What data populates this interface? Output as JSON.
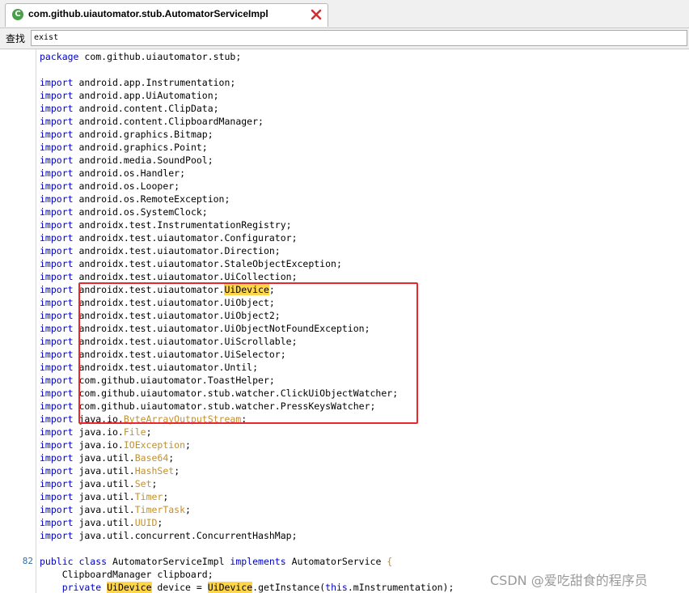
{
  "tab": {
    "title": "com.github.uiautomator.stub.AutomatorServiceImpl",
    "icon": "class-icon",
    "close_icon": "close-icon"
  },
  "find": {
    "label": "查找",
    "value": "exist"
  },
  "highlight_word": "UiDevice",
  "code_lines": [
    {
      "ln": "",
      "segs": [
        [
          "kw",
          "package"
        ],
        [
          "t",
          " com.github.uiautomator.stub;"
        ]
      ]
    },
    {
      "ln": "",
      "segs": []
    },
    {
      "ln": "",
      "segs": [
        [
          "kw",
          "import"
        ],
        [
          "t",
          " android.app.Instrumentation;"
        ]
      ]
    },
    {
      "ln": "",
      "segs": [
        [
          "kw",
          "import"
        ],
        [
          "t",
          " android.app.UiAutomation;"
        ]
      ]
    },
    {
      "ln": "",
      "segs": [
        [
          "kw",
          "import"
        ],
        [
          "t",
          " android.content.ClipData;"
        ]
      ]
    },
    {
      "ln": "",
      "segs": [
        [
          "kw",
          "import"
        ],
        [
          "t",
          " android.content.ClipboardManager;"
        ]
      ]
    },
    {
      "ln": "",
      "segs": [
        [
          "kw",
          "import"
        ],
        [
          "t",
          " android.graphics.Bitmap;"
        ]
      ]
    },
    {
      "ln": "",
      "segs": [
        [
          "kw",
          "import"
        ],
        [
          "t",
          " android.graphics.Point;"
        ]
      ]
    },
    {
      "ln": "",
      "segs": [
        [
          "kw",
          "import"
        ],
        [
          "t",
          " android.media.SoundPool;"
        ]
      ]
    },
    {
      "ln": "",
      "segs": [
        [
          "kw",
          "import"
        ],
        [
          "t",
          " android.os.Handler;"
        ]
      ]
    },
    {
      "ln": "",
      "segs": [
        [
          "kw",
          "import"
        ],
        [
          "t",
          " android.os.Looper;"
        ]
      ]
    },
    {
      "ln": "",
      "segs": [
        [
          "kw",
          "import"
        ],
        [
          "t",
          " android.os.RemoteException;"
        ]
      ]
    },
    {
      "ln": "",
      "segs": [
        [
          "kw",
          "import"
        ],
        [
          "t",
          " android.os.SystemClock;"
        ]
      ]
    },
    {
      "ln": "",
      "segs": [
        [
          "kw",
          "import"
        ],
        [
          "t",
          " androidx.test.InstrumentationRegistry;"
        ]
      ]
    },
    {
      "ln": "",
      "segs": [
        [
          "kw",
          "import"
        ],
        [
          "t",
          " androidx.test.uiautomator.Configurator;"
        ]
      ]
    },
    {
      "ln": "",
      "segs": [
        [
          "kw",
          "import"
        ],
        [
          "t",
          " androidx.test.uiautomator.Direction;"
        ]
      ]
    },
    {
      "ln": "",
      "segs": [
        [
          "kw",
          "import"
        ],
        [
          "t",
          " androidx.test.uiautomator.StaleObjectException;"
        ]
      ]
    },
    {
      "ln": "",
      "segs": [
        [
          "kw",
          "import"
        ],
        [
          "t",
          " androidx.test.uiautomator.UiCollection;"
        ]
      ]
    },
    {
      "ln": "",
      "segs": [
        [
          "kw",
          "import"
        ],
        [
          "t",
          " androidx.test.uiautomator."
        ],
        [
          "hl",
          "UiDevice"
        ],
        [
          "t",
          ";"
        ]
      ]
    },
    {
      "ln": "",
      "segs": [
        [
          "kw",
          "import"
        ],
        [
          "t",
          " androidx.test.uiautomator.UiObject;"
        ]
      ]
    },
    {
      "ln": "",
      "segs": [
        [
          "kw",
          "import"
        ],
        [
          "t",
          " androidx.test.uiautomator.UiObject2;"
        ]
      ]
    },
    {
      "ln": "",
      "segs": [
        [
          "kw",
          "import"
        ],
        [
          "t",
          " androidx.test.uiautomator.UiObjectNotFoundException;"
        ]
      ]
    },
    {
      "ln": "",
      "segs": [
        [
          "kw",
          "import"
        ],
        [
          "t",
          " androidx.test.uiautomator.UiScrollable;"
        ]
      ]
    },
    {
      "ln": "",
      "segs": [
        [
          "kw",
          "import"
        ],
        [
          "t",
          " androidx.test.uiautomator.UiSelector;"
        ]
      ]
    },
    {
      "ln": "",
      "segs": [
        [
          "kw",
          "import"
        ],
        [
          "t",
          " androidx.test.uiautomator.Until;"
        ]
      ]
    },
    {
      "ln": "",
      "segs": [
        [
          "kw",
          "import"
        ],
        [
          "t",
          " com.github.uiautomator.ToastHelper;"
        ]
      ]
    },
    {
      "ln": "",
      "segs": [
        [
          "kw",
          "import"
        ],
        [
          "t",
          " com.github.uiautomator.stub.watcher.ClickUiObjectWatcher;"
        ]
      ]
    },
    {
      "ln": "",
      "segs": [
        [
          "kw",
          "import"
        ],
        [
          "t",
          " com.github.uiautomator.stub.watcher.PressKeysWatcher;"
        ]
      ]
    },
    {
      "ln": "",
      "segs": [
        [
          "kw",
          "import"
        ],
        [
          "t",
          " java.io."
        ],
        [
          "cls",
          "ByteArrayOutputStream"
        ],
        [
          "t",
          ";"
        ]
      ]
    },
    {
      "ln": "",
      "segs": [
        [
          "kw",
          "import"
        ],
        [
          "t",
          " java.io."
        ],
        [
          "cls",
          "File"
        ],
        [
          "t",
          ";"
        ]
      ]
    },
    {
      "ln": "",
      "segs": [
        [
          "kw",
          "import"
        ],
        [
          "t",
          " java.io."
        ],
        [
          "cls",
          "IOException"
        ],
        [
          "t",
          ";"
        ]
      ]
    },
    {
      "ln": "",
      "segs": [
        [
          "kw",
          "import"
        ],
        [
          "t",
          " java.util."
        ],
        [
          "cls",
          "Base64"
        ],
        [
          "t",
          ";"
        ]
      ]
    },
    {
      "ln": "",
      "segs": [
        [
          "kw",
          "import"
        ],
        [
          "t",
          " java.util."
        ],
        [
          "cls",
          "HashSet"
        ],
        [
          "t",
          ";"
        ]
      ]
    },
    {
      "ln": "",
      "segs": [
        [
          "kw",
          "import"
        ],
        [
          "t",
          " java.util."
        ],
        [
          "cls",
          "Set"
        ],
        [
          "t",
          ";"
        ]
      ]
    },
    {
      "ln": "",
      "segs": [
        [
          "kw",
          "import"
        ],
        [
          "t",
          " java.util."
        ],
        [
          "cls",
          "Timer"
        ],
        [
          "t",
          ";"
        ]
      ]
    },
    {
      "ln": "",
      "segs": [
        [
          "kw",
          "import"
        ],
        [
          "t",
          " java.util."
        ],
        [
          "cls",
          "TimerTask"
        ],
        [
          "t",
          ";"
        ]
      ]
    },
    {
      "ln": "",
      "segs": [
        [
          "kw",
          "import"
        ],
        [
          "t",
          " java.util."
        ],
        [
          "cls",
          "UUID"
        ],
        [
          "t",
          ";"
        ]
      ]
    },
    {
      "ln": "",
      "segs": [
        [
          "kw",
          "import"
        ],
        [
          "t",
          " java.util.concurrent.ConcurrentHashMap;"
        ]
      ]
    },
    {
      "ln": "",
      "segs": []
    },
    {
      "ln": "82",
      "segs": [
        [
          "kw",
          "public class"
        ],
        [
          "t",
          " AutomatorServiceImpl "
        ],
        [
          "kw",
          "implements"
        ],
        [
          "t",
          " AutomatorService "
        ],
        [
          "cls",
          "{"
        ]
      ]
    },
    {
      "ln": "",
      "segs": [
        [
          "t",
          "    ClipboardManager clipboard;"
        ]
      ]
    },
    {
      "ln": "",
      "segs": [
        [
          "t",
          "    "
        ],
        [
          "kw",
          "private"
        ],
        [
          "t",
          " "
        ],
        [
          "hl",
          "UiDevice"
        ],
        [
          "t",
          " device = "
        ],
        [
          "hl",
          "UiDevice"
        ],
        [
          "t",
          ".getInstance("
        ],
        [
          "kw",
          "this"
        ],
        [
          "t",
          ".mInstrumentation);"
        ]
      ]
    }
  ],
  "watermark": "CSDN @爱吃甜食的程序员"
}
